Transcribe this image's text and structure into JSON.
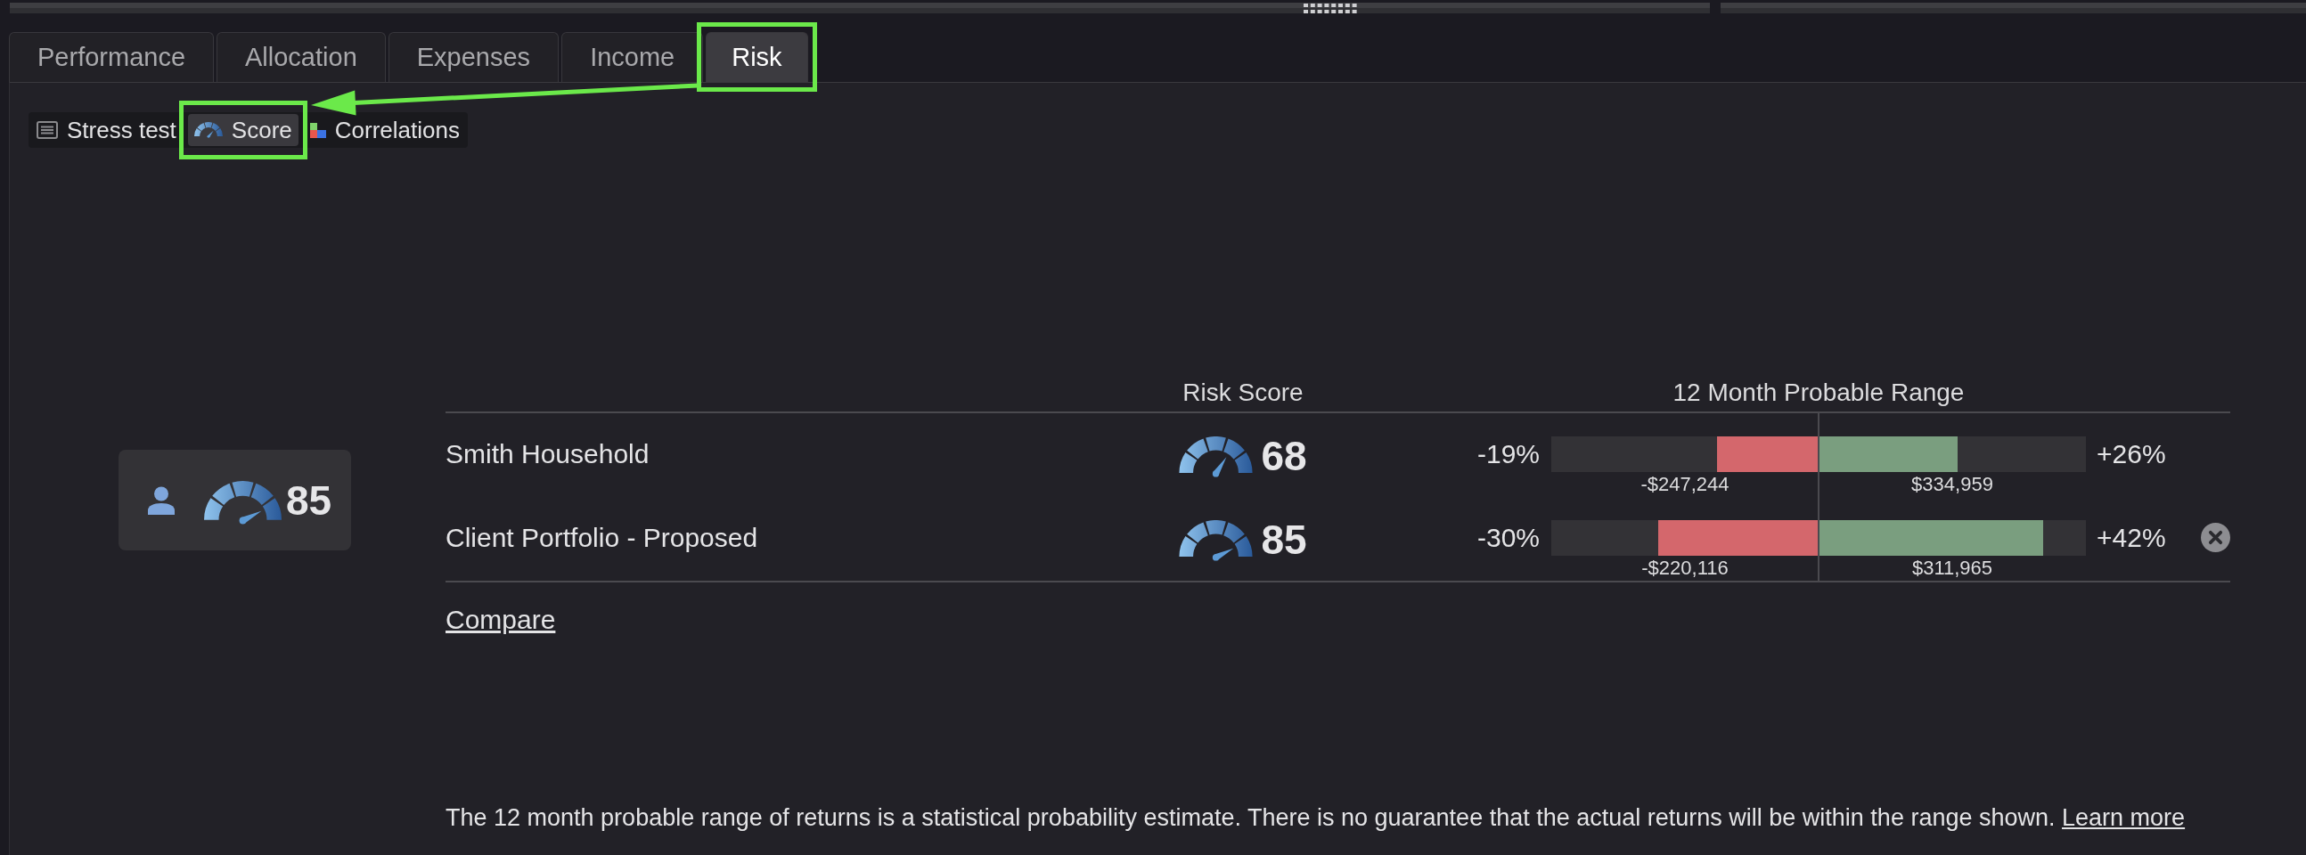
{
  "tabs": [
    {
      "label": "Performance",
      "selected": false,
      "highlighted": false
    },
    {
      "label": "Allocation",
      "selected": false,
      "highlighted": false
    },
    {
      "label": "Expenses",
      "selected": false,
      "highlighted": false
    },
    {
      "label": "Income",
      "selected": false,
      "highlighted": false
    },
    {
      "label": "Risk",
      "selected": true,
      "highlighted": true
    }
  ],
  "subtabs": [
    {
      "label": "Stress test",
      "selected": false,
      "highlighted": false
    },
    {
      "label": "Score",
      "selected": true,
      "highlighted": true
    },
    {
      "label": "Correlations",
      "selected": false,
      "highlighted": false
    }
  ],
  "summary_card": {
    "score": "85"
  },
  "table": {
    "columns": [
      "Risk Score",
      "12 Month Probable Range"
    ],
    "rows": [
      {
        "name": "Smith Household",
        "score": "68",
        "range": {
          "downside": {
            "percent": "-19%",
            "amount": "-$247,244",
            "level": 0.38
          },
          "upside": {
            "percent": "+26%",
            "amount": "$334,959",
            "level": 0.52
          }
        },
        "removable": false
      },
      {
        "name": "Client Portfolio - Proposed",
        "score": "85",
        "range": {
          "downside": {
            "percent": "-30%",
            "amount": "-$220,116",
            "level": 0.6
          },
          "upside": {
            "percent": "+42%",
            "amount": "$311,965",
            "level": 0.84
          }
        },
        "removable": true
      }
    ]
  },
  "compare_link": "Compare",
  "disclaimer": {
    "text": "The 12 month probable range of returns is a statistical probability estimate. There is no guarantee that the actual returns will be within the range shown.",
    "link": "Learn more"
  }
}
